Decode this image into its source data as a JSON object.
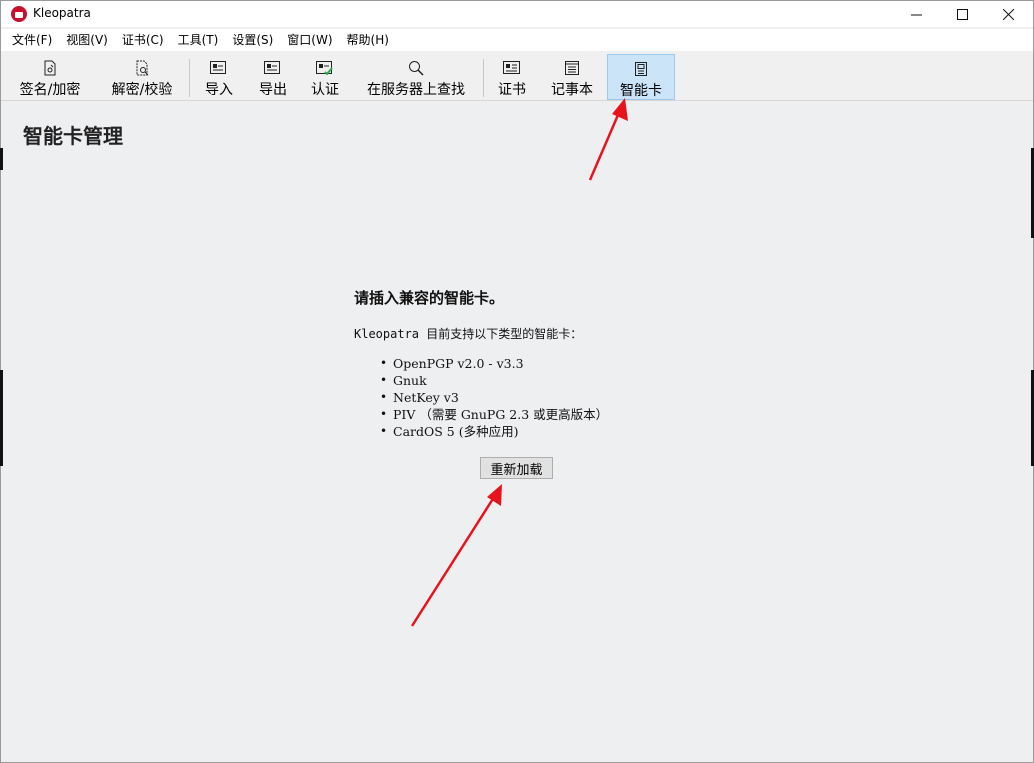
{
  "window": {
    "title": "Kleopatra"
  },
  "menubar": {
    "items": [
      "文件(F)",
      "视图(V)",
      "证书(C)",
      "工具(T)",
      "设置(S)",
      "窗口(W)",
      "帮助(H)"
    ]
  },
  "toolbar": {
    "buttons": [
      {
        "label": "签名/加密",
        "icon": "sign-encrypt-icon"
      },
      {
        "label": "解密/校验",
        "icon": "decrypt-verify-icon"
      },
      {
        "label": "导入",
        "icon": "import-icon"
      },
      {
        "label": "导出",
        "icon": "export-icon"
      },
      {
        "label": "认证",
        "icon": "certify-icon"
      },
      {
        "label": "在服务器上查找",
        "icon": "search-icon"
      },
      {
        "label": "证书",
        "icon": "certificates-icon"
      },
      {
        "label": "记事本",
        "icon": "notepad-icon"
      },
      {
        "label": "智能卡",
        "icon": "smartcard-icon",
        "active": true
      }
    ]
  },
  "page": {
    "title": "智能卡管理",
    "heading": "请插入兼容的智能卡。",
    "intro": "Kleopatra 目前支持以下类型的智能卡：",
    "cards": [
      "OpenPGP v2.0 - v3.3",
      "Gnuk",
      "NetKey v3",
      "PIV （需要 GnuPG 2.3 或更高版本）",
      "CardOS 5 (多种应用)"
    ],
    "reload_label": "重新加载"
  },
  "colors": {
    "active_tab_bg": "#cce4f7",
    "annotation_arrow": "#e8141c",
    "content_bg": "#eeeff1"
  }
}
